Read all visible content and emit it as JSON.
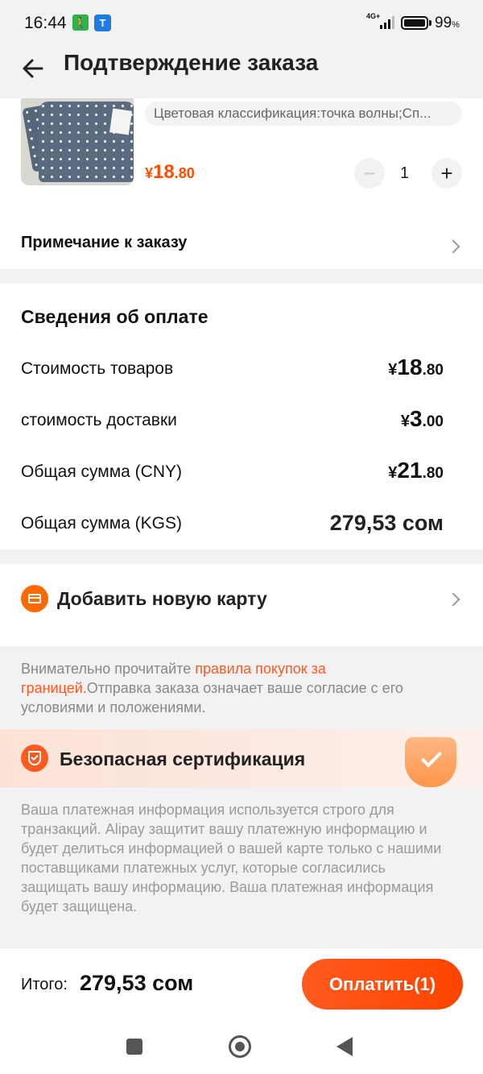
{
  "status_bar": {
    "time": "16:44",
    "network": "4G+",
    "battery": "99",
    "battery_unit": "%"
  },
  "header": {
    "title": "Подтверждение заказа",
    "back_icon": "arrow-left-icon"
  },
  "product": {
    "variant": "Цветовая классификация:точка волны;Сп...",
    "price_currency": "¥",
    "price_int": "18",
    "price_dec": ".80",
    "quantity": "1",
    "minus_label": "−",
    "plus_label": "+"
  },
  "order_note": {
    "label": "Примечание к заказу"
  },
  "payment_info": {
    "title": "Сведения об оплате",
    "rows": [
      {
        "label": "Стоимость товаров",
        "currency": "¥",
        "int": "18",
        "dec": ".80"
      },
      {
        "label": "стоимость доставки",
        "currency": "¥",
        "int": "3",
        "dec": ".00"
      },
      {
        "label": "Общая сумма (CNY)",
        "currency": "¥",
        "int": "21",
        "dec": ".80"
      }
    ],
    "kgs_label": "Общая сумма (KGS)",
    "kgs_value": "279,53 сом"
  },
  "add_card": {
    "label": "Добавить новую карту",
    "icon": "credit-card-icon"
  },
  "rules": {
    "prefix": "Внимательно прочитайте ",
    "link": "правила покупок за границей.",
    "suffix": "Отправка заказа означает ваше согласие с его условиями и положениями."
  },
  "secure": {
    "title": "Безопасная сертификация",
    "text": "Ваша платежная информация используется строго для транзакций. Alipay защитит вашу платежную информацию и будет делиться информацией о вашей карте только с нашими поставщиками платежных услуг, которые согласились защищать вашу информацию. Ваша платежная информация будет защищена.",
    "icon": "shield-check-icon"
  },
  "bottom": {
    "total_label": "Итого:",
    "total_value": "279,53 сом",
    "pay_button": "Оплатить(1)"
  },
  "colors": {
    "accent": "#ff5a1f",
    "price": "#ff4c00",
    "background": "#f2f2f4"
  }
}
